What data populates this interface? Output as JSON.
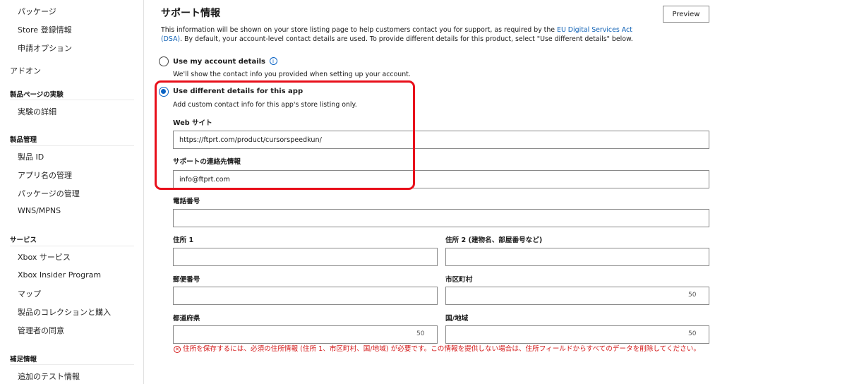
{
  "sidebar": {
    "items": [
      {
        "label": "パッケージ"
      },
      {
        "label": "Store 登録情報"
      },
      {
        "label": "申請オプション"
      },
      {
        "label": "アドオン"
      },
      {
        "label": "実験の詳細"
      },
      {
        "label": "製品 ID"
      },
      {
        "label": "アプリ名の管理"
      },
      {
        "label": "パッケージの管理"
      },
      {
        "label": "WNS/MPNS"
      },
      {
        "label": "Xbox サービス"
      },
      {
        "label": "Xbox Insider Program"
      },
      {
        "label": "マップ"
      },
      {
        "label": "製品のコレクションと購入"
      },
      {
        "label": "管理者の同意"
      },
      {
        "label": "追加のテスト情報"
      }
    ],
    "headings": [
      {
        "label": "製品ページの実験"
      },
      {
        "label": "製品管理"
      },
      {
        "label": "サービス"
      },
      {
        "label": "補足情報"
      }
    ]
  },
  "main": {
    "title": "サポート情報",
    "preview_label": "Preview",
    "description_before": "This information will be shown on your store listing page to help customers contact you for support, as required by the ",
    "description_link": "EU Digital Services Act (DSA)",
    "description_after": ". By default, your account-level contact details are used. To provide different details for this product, select \"Use different details\" below.",
    "option_account": {
      "label": "Use my account details",
      "hint": "We'll show the contact info you provided when setting up your account."
    },
    "option_different": {
      "label": "Use different details for this app",
      "hint": "Add custom contact info for this app's store listing only."
    },
    "fields": {
      "website": {
        "label": "Web サイト",
        "value": "https://ftprt.com/product/cursorspeedkun/"
      },
      "support_contact": {
        "label": "サポートの連絡先情報",
        "value": "info@ftprt.com"
      },
      "phone": {
        "label": "電話番号",
        "value": ""
      },
      "address1": {
        "label": "住所 1",
        "value": ""
      },
      "address2": {
        "label": "住所 2 (建物名、部屋番号など)",
        "value": ""
      },
      "postal": {
        "label": "郵便番号",
        "value": ""
      },
      "city": {
        "label": "市区町村",
        "value": "",
        "counter": "50"
      },
      "prefecture": {
        "label": "都道府県",
        "value": "",
        "counter": "50"
      },
      "country": {
        "label": "国/地域",
        "value": "",
        "counter": "50"
      }
    },
    "error_text": "住所を保存するには、必須の住所情報 (住所 1、市区町村、国/地域) が必要です。この情報を提供しない場合は、住所フィールドからすべてのデータを削除してください。"
  },
  "colors": {
    "accent": "#0a63c4",
    "link": "#1062b5",
    "highlight_border": "#e8101b",
    "error": "#d41a1a"
  },
  "icons": [
    "info-icon",
    "error-circle-icon"
  ]
}
